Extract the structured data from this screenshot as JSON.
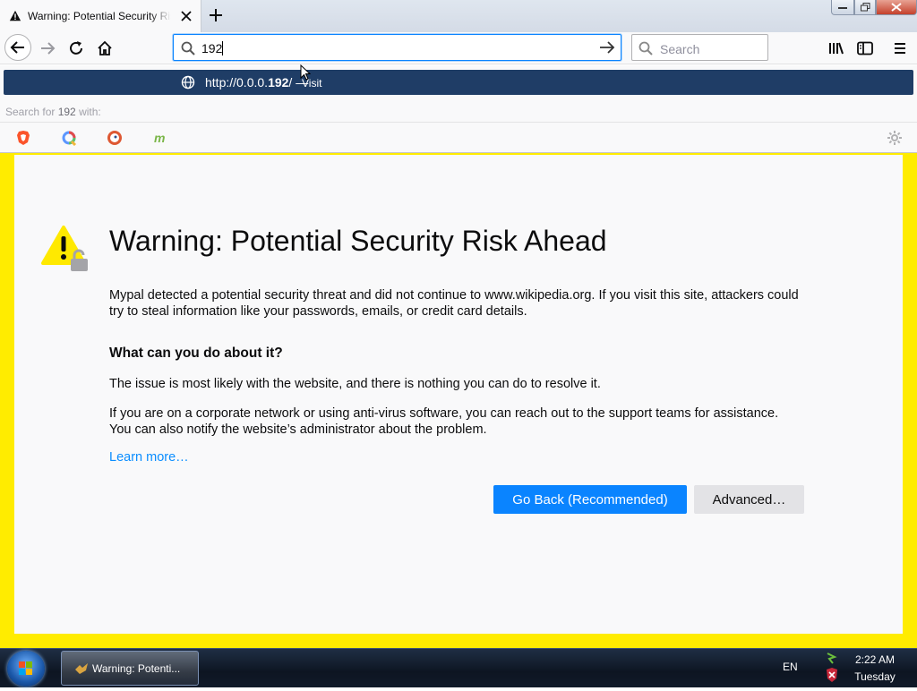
{
  "tab": {
    "title": "Warning: Potential Security Risk Ahead"
  },
  "urlbar": {
    "value": "192"
  },
  "searchbar": {
    "placeholder": "Search"
  },
  "suggestion": {
    "url_prefix": "http://0.0.0.",
    "url_match": "192",
    "url_suffix": "/",
    "separator": "—",
    "action": "Visit"
  },
  "search_for": {
    "prefix": "Search for",
    "query": "192",
    "suffix": "with:"
  },
  "engines": [
    "brave-icon",
    "qwant-icon",
    "duckduckgo-icon",
    "mojeek-icon"
  ],
  "page": {
    "title": "Warning: Potential Security Risk Ahead",
    "intro": "Mypal detected a potential security threat and did not continue to www.wikipedia.org. If you visit this site, attackers could try to steal information like your passwords, emails, or credit card details.",
    "subheading": "What can you do about it?",
    "para1": "The issue is most likely with the website, and there is nothing you can do to resolve it.",
    "para2": "If you are on a corporate network or using anti-virus software, you can reach out to the support teams for assistance. You can also notify the website’s administrator about the problem.",
    "learn_more": "Learn more…",
    "go_back": "Go Back (Recommended)",
    "advanced": "Advanced…"
  },
  "taskbar": {
    "item": "Warning: Potenti...",
    "lang": "EN",
    "time": "2:22 AM",
    "day": "Tuesday"
  },
  "colors": {
    "accent": "#0a84ff",
    "suggestion_bg": "#1f3d66",
    "frame": "#ffec00"
  }
}
